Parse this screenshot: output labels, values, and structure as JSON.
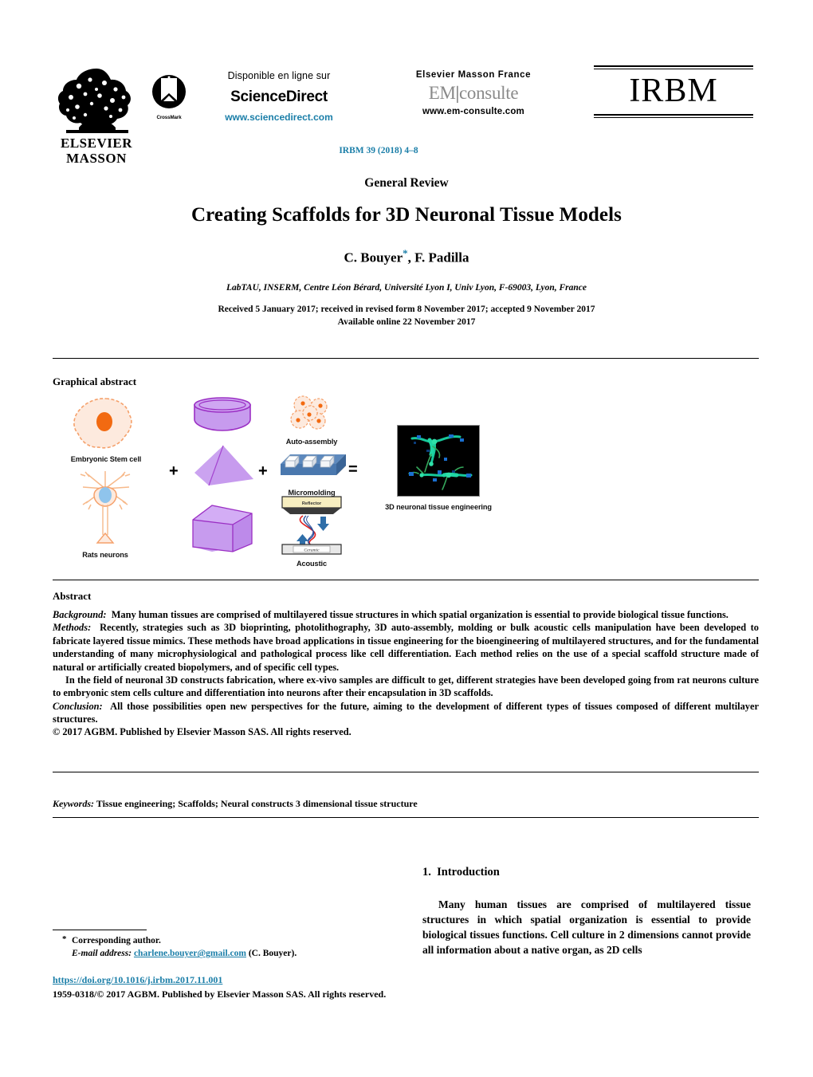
{
  "header": {
    "publisher_logo_line1": "ELSEVIER",
    "publisher_logo_line2": "MASSON",
    "crossmark_label": "CrossMark",
    "sciencedirect_top": "Disponible en ligne sur",
    "sciencedirect_brand": "ScienceDirect",
    "sciencedirect_url": "www.sciencedirect.com",
    "em_top": "Elsevier Masson France",
    "em_brand_left": "EM",
    "em_brand_right": "consulte",
    "em_url": "www.em-consulte.com",
    "journal_logo": "IRBM",
    "journal_reference": "IRBM 39 (2018) 4–8"
  },
  "title_block": {
    "article_type": "General Review",
    "title": "Creating Scaffolds for 3D Neuronal Tissue Models",
    "authors": "C. Bouyer",
    "authors_marker": "*",
    "authors_rest": ", F. Padilla",
    "affiliation": "LabTAU, INSERM, Centre Léon Bérard, Université Lyon I, Univ Lyon, F-69003, Lyon, France",
    "received_line": "Received 5 January 2017; received in revised form 8 November 2017; accepted 9 November 2017",
    "available_line": "Available online 22 November 2017"
  },
  "graphical_abstract": {
    "heading": "Graphical abstract",
    "labels": {
      "embryonic": "Embryonic Stem cell",
      "rats": "Rats neurons",
      "auto_assembly": "Auto-assembly",
      "micromolding": "Micromolding",
      "acoustic": "Acoustic",
      "reflector": "Reflector",
      "ceramic": "Ceramic",
      "result": "3D neuronal tissue engineering",
      "plus1": "+",
      "plus2": "+",
      "equals": "="
    },
    "colors": {
      "shape_fill": "#c79bee",
      "shape_stroke": "#9b2fc4",
      "cell_fill": "#fdeade",
      "cell_stroke": "#f5a06a",
      "nucleus": "#f26a11",
      "neuron_nucleus": "#8fc4ec",
      "mold_blue": "#4a78ae",
      "reflector_yellow": "#f7eec0",
      "wave_red": "#e02020",
      "wave_blue": "#2a4f9b",
      "micro_bg": "#000000"
    }
  },
  "abstract": {
    "heading": "Abstract",
    "background_label": "Background:",
    "background_text": "Many human tissues are comprised of multilayered tissue structures in which spatial organization is essential to provide biological tissue functions.",
    "methods_label": "Methods:",
    "methods_text": "Recently, strategies such as 3D bioprinting, photolithography, 3D auto-assembly, molding or bulk acoustic cells manipulation have been developed to fabricate layered tissue mimics. These methods have broad applications in tissue engineering for the bioengineering of multilayered structures, and for the fundamental understanding of many microphysiological and pathological process like cell differentiation. Each method relies on the use of a special scaffold structure made of natural or artificially created biopolymers, and of specific cell types.",
    "paragraph3": "In the field of neuronal 3D constructs fabrication, where ex-vivo samples are difficult to get, different strategies have been developed going from rat neurons culture to embryonic stem cells culture and differentiation into neurons after their encapsulation in 3D scaffolds.",
    "conclusion_label": "Conclusion:",
    "conclusion_text": "All those possibilities open new perspectives for the future, aiming to the development of different types of tissues composed of different multilayer structures.",
    "rights": "© 2017 AGBM. Published by Elsevier Masson SAS. All rights reserved.",
    "keywords_label": "Keywords:",
    "keywords_text": "Tissue engineering; Scaffolds; Neural constructs 3 dimensional tissue structure"
  },
  "body": {
    "section_number": "1.",
    "section_title": "Introduction",
    "intro_paragraph": "Many human tissues are comprised of multilayered tissue structures in which spatial organization is essential to provide biological tissues functions. Cell culture in 2 dimensions cannot provide all information about a native organ, as 2D cells"
  },
  "footer": {
    "corresponding_author": "Corresponding author.",
    "email_label": "E-mail address:",
    "email": "charlene.bouyer@gmail.com",
    "email_suffix": "(C. Bouyer).",
    "doi": "https://doi.org/10.1016/j.irbm.2017.11.001",
    "copyright": "1959-0318/© 2017 AGBM. Published by Elsevier Masson SAS. All rights reserved."
  }
}
